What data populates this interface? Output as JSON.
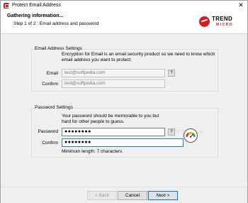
{
  "window": {
    "title": "Protect Email Address",
    "close_glyph": "✕"
  },
  "header": {
    "title": "Gathering information...",
    "subtitle": "Step 1 of 2 : Email address and password",
    "logo_line1": "TREND",
    "logo_line2": "MICRO"
  },
  "email_section": {
    "legend": "Email Address Settings",
    "description": "Encryption for Email is an email security product so we need to know which email address you want to protect.",
    "email_label": "Email",
    "email_value": "test@softpedia.com",
    "confirm_label": "Confirm",
    "confirm_value": "test@softpedia.com",
    "help_label": "?"
  },
  "password_section": {
    "legend": "Password Settings",
    "description": "Your password should be memorable to you but hard for other people to guess.",
    "password_label": "Password",
    "password_value": "●●●●●●●●",
    "confirm_label": "Confirm",
    "confirm_value": "●●●●●●●●",
    "help_label": "?",
    "hint": "Minimum length: 7 characters"
  },
  "watermark": "SOFTPEDIA",
  "footer": {
    "back_label": "< Back",
    "cancel_label": "Cancel",
    "next_label": "Next >"
  },
  "colors": {
    "brand_red": "#d71920",
    "focus_blue": "#2d7ad6",
    "gauge_red": "#d62d20",
    "gauge_yellow": "#e8b400",
    "gauge_green": "#2e9e3a"
  },
  "icons": {
    "app": "app-icon",
    "close": "close-icon",
    "strength": "password-strength-gauge-icon"
  }
}
